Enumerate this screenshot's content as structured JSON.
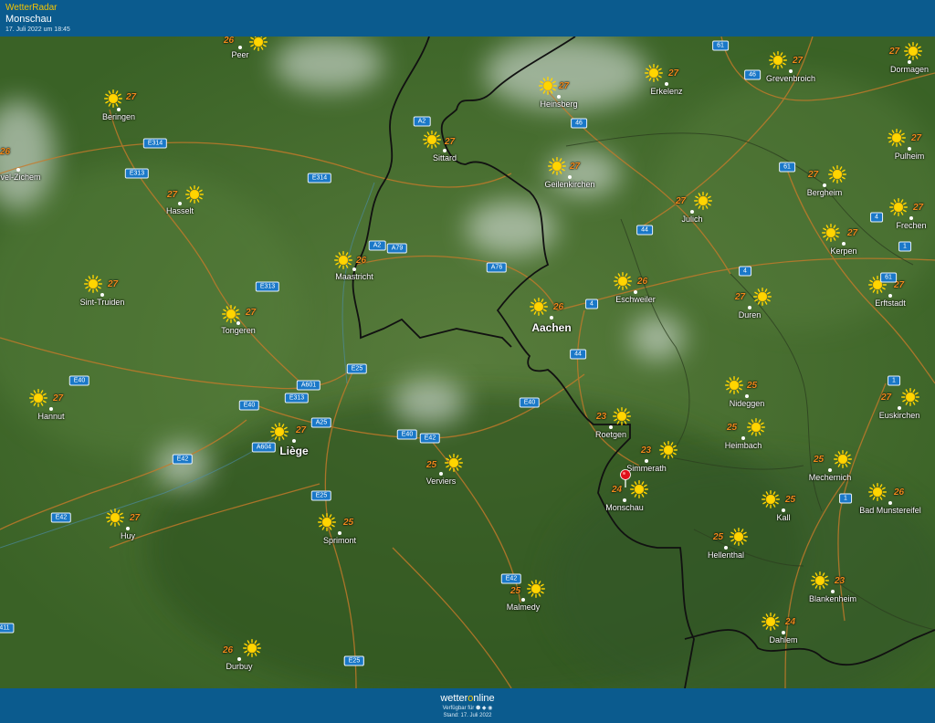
{
  "header": {
    "brand": "WetterRadar",
    "location": "Monschau",
    "timestamp": "17. Juli 2022 um 18:45"
  },
  "footer": {
    "logo_left": "wetter",
    "logo_mid": "o",
    "logo_right": "nline",
    "available": "Verfügbar für ⬢ ◆ ◉",
    "stand": "Stand: 17. Juli 2022"
  },
  "colors": {
    "header_bg": "#0b5b8e",
    "map_green": "#3f6a2a",
    "temp_orange": "#f08a1c",
    "sun_yellow": "#ffd500",
    "road_orange": "#c77a2a",
    "shield_blue": "#1a78c8",
    "border_black": "#111111",
    "pin_red": "#e0101a"
  },
  "icons": {
    "weather": "sun-icon",
    "marker": "map-pin-icon"
  },
  "cities": [
    {
      "name": "Peer",
      "temp": "26"
    },
    {
      "name": "Beringen",
      "temp": "27"
    },
    {
      "name": "Hasselt",
      "temp": "27"
    },
    {
      "name": "Sint-Truiden",
      "temp": "27"
    },
    {
      "name": "Tongeren",
      "temp": "27"
    },
    {
      "name": "Hannut",
      "temp": "27"
    },
    {
      "name": "Huy",
      "temp": "27"
    },
    {
      "name": "Durbuy",
      "temp": "26"
    },
    {
      "name": "Maastricht",
      "temp": "26"
    },
    {
      "name": "Liège",
      "temp": "27"
    },
    {
      "name": "Sprimont",
      "temp": "25"
    },
    {
      "name": "Verviers",
      "temp": "25"
    },
    {
      "name": "Malmedy",
      "temp": "25"
    },
    {
      "name": "Sittard",
      "temp": "27"
    },
    {
      "name": "Heinsberg",
      "temp": "27"
    },
    {
      "name": "Geilenkirchen",
      "temp": "27"
    },
    {
      "name": "Aachen",
      "temp": "26"
    },
    {
      "name": "Eschweiler",
      "temp": "26"
    },
    {
      "name": "Roetgen",
      "temp": "23"
    },
    {
      "name": "Simmerath",
      "temp": "23"
    },
    {
      "name": "Monschau",
      "temp": "24"
    },
    {
      "name": "Erkelenz",
      "temp": "27"
    },
    {
      "name": "Julich",
      "temp": "27"
    },
    {
      "name": "Duren",
      "temp": "27"
    },
    {
      "name": "Nideggen",
      "temp": "25"
    },
    {
      "name": "Heimbach",
      "temp": "25"
    },
    {
      "name": "Hellenthal",
      "temp": "25"
    },
    {
      "name": "Kall",
      "temp": "25"
    },
    {
      "name": "Mechernich",
      "temp": "25"
    },
    {
      "name": "Blankenheim",
      "temp": "23"
    },
    {
      "name": "Dahlem",
      "temp": "24"
    },
    {
      "name": "Grevenbroich",
      "temp": "27"
    },
    {
      "name": "Dormagen",
      "temp": "27"
    },
    {
      "name": "Pulheim",
      "temp": "27"
    },
    {
      "name": "Bergheim",
      "temp": "27"
    },
    {
      "name": "Frechen",
      "temp": "27"
    },
    {
      "name": "Kerpen",
      "temp": "27"
    },
    {
      "name": "Erftstadt",
      "temp": "27"
    },
    {
      "name": "Euskirchen",
      "temp": "27"
    },
    {
      "name": "Bad Munstereifel",
      "temp": "26"
    },
    {
      "name": "uvel-Zichem",
      "temp": "26"
    }
  ],
  "roads": [
    "E314",
    "E313",
    "E314",
    "E313",
    "E40",
    "E40",
    "A601",
    "E313",
    "E25",
    "A25",
    "A604",
    "E42",
    "E42",
    "E40",
    "E42",
    "E25",
    "E25",
    "E42",
    "E25",
    "E40",
    "44",
    "4",
    "A2",
    "A2",
    "A79",
    "A76",
    "46",
    "61",
    "46",
    "61",
    "44",
    "4",
    "4",
    "1",
    "61",
    "1",
    "1",
    "411"
  ]
}
